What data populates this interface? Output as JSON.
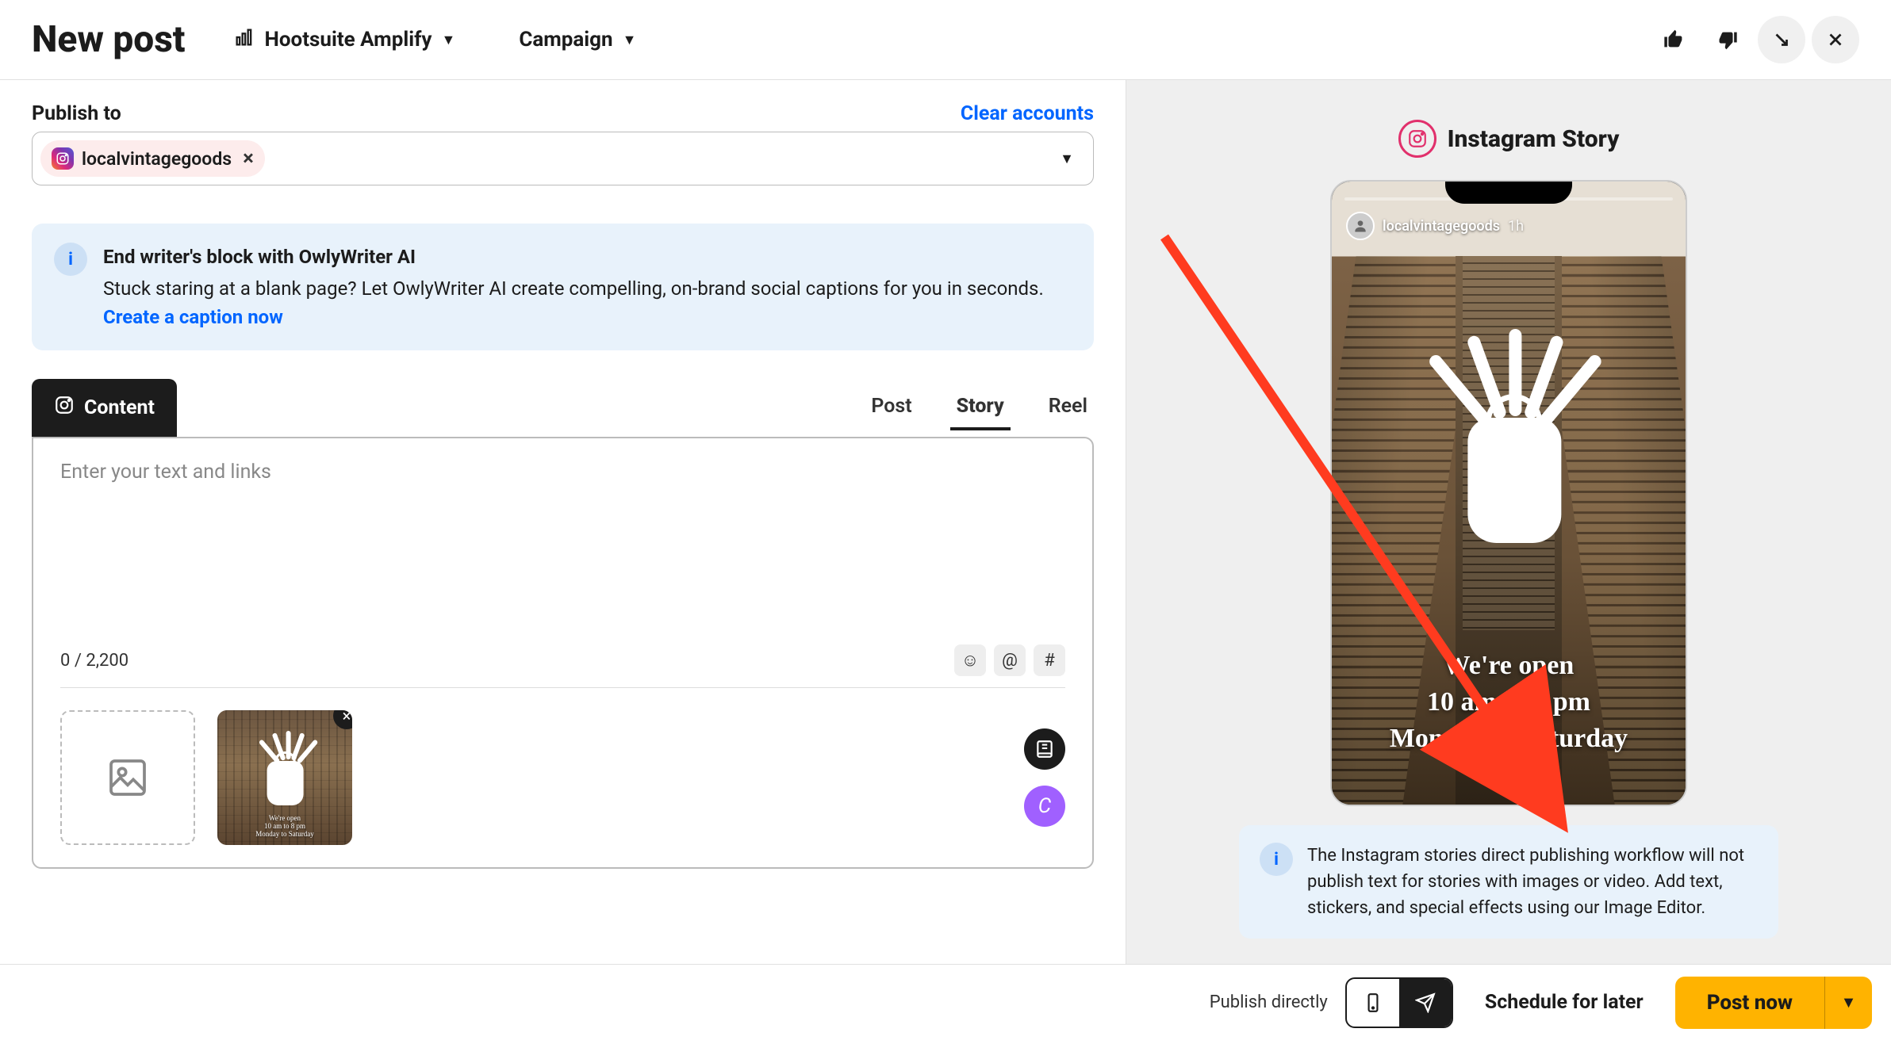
{
  "header": {
    "title": "New post",
    "amplify": "Hootsuite Amplify",
    "campaign": "Campaign"
  },
  "publish": {
    "label": "Publish to",
    "clear": "Clear accounts",
    "account": "localvintagegoods"
  },
  "ai_card": {
    "title": "End writer's block with OwlyWriter AI",
    "body": "Stuck staring at a blank page? Let OwlyWriter AI create compelling, on-brand social captions for you in seconds. ",
    "link": "Create a caption now"
  },
  "tabs": {
    "content": "Content",
    "post": "Post",
    "story": "Story",
    "reel": "Reel"
  },
  "editor": {
    "placeholder": "Enter your text and links",
    "char_count": "0 / 2,200"
  },
  "preview": {
    "title": "Instagram Story",
    "username": "localvintagegoods",
    "time": "1h",
    "line1": "We're open",
    "line2": "10 am to 8 pm",
    "line3": "Monday to Saturday",
    "info": "The Instagram stories direct publishing workflow will not publish text for stories with images or video. Add text, stickers, and special effects using our Image Editor."
  },
  "footer": {
    "publish_directly": "Publish directly",
    "schedule": "Schedule for later",
    "post_now": "Post now"
  },
  "canva": "C"
}
